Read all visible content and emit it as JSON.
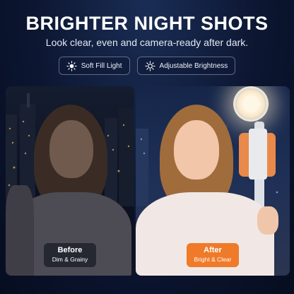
{
  "header": {
    "title": "BRIGHTER NIGHT SHOTS",
    "subtitle": "Look clear, even and camera-ready after dark."
  },
  "features": [
    {
      "label": "Soft Fill Light",
      "icon": "sun-icon"
    },
    {
      "label": "Adjustable Brightness",
      "icon": "brightness-icon"
    }
  ],
  "panels": {
    "before": {
      "title": "Before",
      "caption": "Dim & Grainy"
    },
    "after": {
      "title": "After",
      "caption": "Bright & Clear"
    }
  },
  "colors": {
    "background": "#0c1631",
    "accent": "#ef7a2a",
    "phone": "#e98a4a"
  }
}
